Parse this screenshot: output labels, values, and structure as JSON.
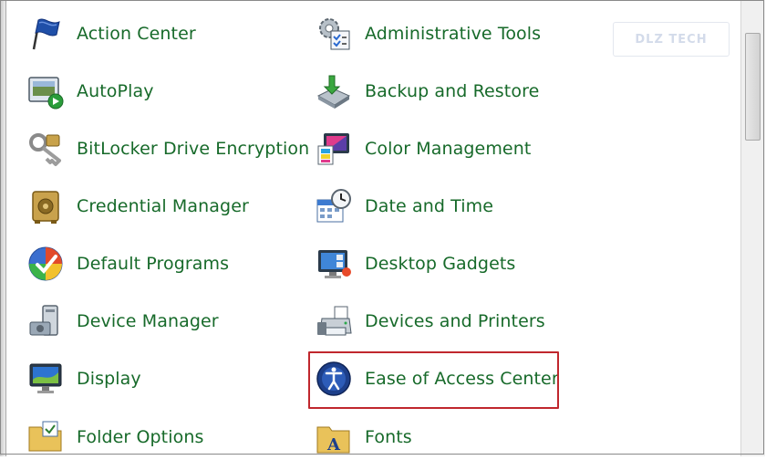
{
  "column1": [
    {
      "label": "Action Center",
      "icon": "flag-icon"
    },
    {
      "label": "AutoPlay",
      "icon": "autoplay-icon"
    },
    {
      "label": "BitLocker Drive Encryption",
      "icon": "bitlocker-key-icon"
    },
    {
      "label": "Credential Manager",
      "icon": "vault-icon"
    },
    {
      "label": "Default Programs",
      "icon": "default-programs-icon"
    },
    {
      "label": "Device Manager",
      "icon": "device-manager-icon"
    },
    {
      "label": "Display",
      "icon": "display-icon"
    },
    {
      "label": "Folder Options",
      "icon": "folder-options-icon"
    }
  ],
  "column2": [
    {
      "label": "Administrative Tools",
      "icon": "admin-tools-icon"
    },
    {
      "label": "Backup and Restore",
      "icon": "backup-icon"
    },
    {
      "label": "Color Management",
      "icon": "color-management-icon"
    },
    {
      "label": "Date and Time",
      "icon": "date-time-icon"
    },
    {
      "label": "Desktop Gadgets",
      "icon": "desktop-gadgets-icon"
    },
    {
      "label": "Devices and Printers",
      "icon": "printer-icon"
    },
    {
      "label": "Ease of Access Center",
      "icon": "ease-of-access-icon"
    },
    {
      "label": "Fonts",
      "icon": "fonts-icon"
    }
  ],
  "highlighted_item": "Ease of Access Center",
  "watermark": "DLZ TECH",
  "colors": {
    "link_text": "#176a2a",
    "highlight_border": "#c0272d"
  }
}
